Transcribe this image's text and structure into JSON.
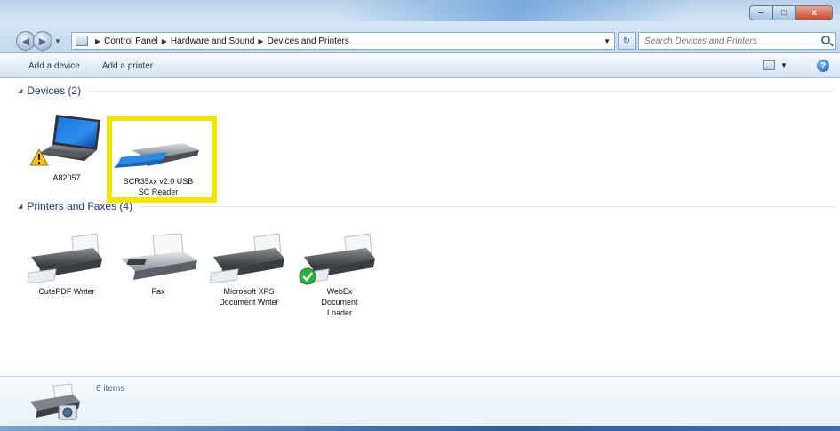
{
  "window": {
    "controls": {
      "minimize": "–",
      "maximize": "□",
      "close": "x"
    }
  },
  "address_bar": {
    "breadcrumbs": [
      "Control Panel",
      "Hardware and Sound",
      "Devices and Printers"
    ]
  },
  "search": {
    "placeholder": "Search Devices and Printers"
  },
  "command_bar": {
    "add_device": "Add a device",
    "add_printer": "Add a printer",
    "help": "?"
  },
  "groups": {
    "devices": {
      "title": "Devices (2)",
      "items": [
        {
          "label": "A82057",
          "icon": "laptop-icon",
          "status": "warning"
        },
        {
          "label_line1": "SCR35xx v2.0 USB",
          "label_line2": "SC Reader",
          "icon": "smart-card-reader-icon",
          "highlighted": true
        }
      ]
    },
    "printers": {
      "title": "Printers and Faxes (4)",
      "items": [
        {
          "label_line1": "CutePDF Writer",
          "icon": "printer-icon"
        },
        {
          "label_line1": "Fax",
          "icon": "fax-icon"
        },
        {
          "label_line1": "Microsoft XPS",
          "label_line2": "Document Writer",
          "icon": "printer-icon"
        },
        {
          "label_line1": "WebEx",
          "label_line2": "Document",
          "label_line3": "Loader",
          "icon": "printer-icon",
          "status": "default"
        }
      ]
    }
  },
  "details": {
    "count": "6 items"
  },
  "colors": {
    "highlight": "#f2e600",
    "group_title": "#1e3287"
  }
}
